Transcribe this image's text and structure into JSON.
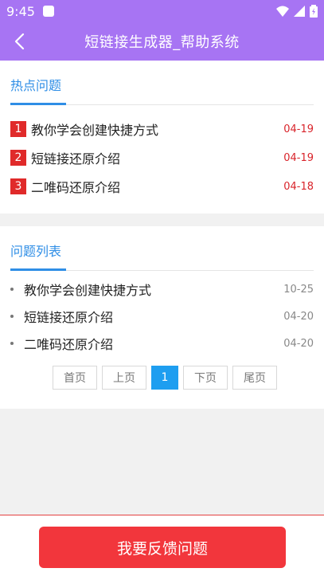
{
  "status": {
    "time": "9:45"
  },
  "header": {
    "title": "短链接生成器_帮助系统"
  },
  "hot": {
    "title": "热点问题",
    "items": [
      {
        "num": "1",
        "text": "教你学会创建快捷方式",
        "date": "04-19"
      },
      {
        "num": "2",
        "text": "短链接还原介绍",
        "date": "04-19"
      },
      {
        "num": "3",
        "text": "二唯码还原介绍",
        "date": "04-18"
      }
    ]
  },
  "list": {
    "title": "问题列表",
    "items": [
      {
        "text": "教你学会创建快捷方式",
        "date": "10-25"
      },
      {
        "text": "短链接还原介绍",
        "date": "04-20"
      },
      {
        "text": "二唯码还原介绍",
        "date": "04-20"
      }
    ]
  },
  "pager": {
    "first": "首页",
    "prev": "上页",
    "current": "1",
    "next": "下页",
    "last": "尾页"
  },
  "footer": {
    "button": "我要反馈问题"
  },
  "colors": {
    "header": "#a774f3",
    "accent": "#2f8ee6",
    "hot": "#e02a2a",
    "button": "#f2363c",
    "pager_active": "#1e9ef0"
  }
}
